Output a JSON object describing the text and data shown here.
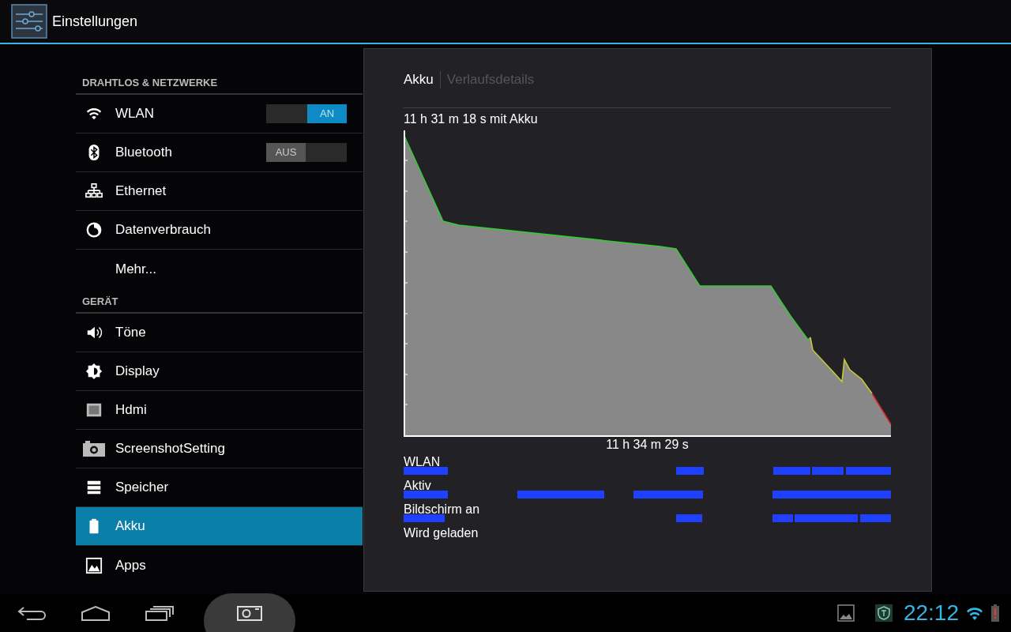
{
  "action_bar": {
    "title": "Einstellungen"
  },
  "sections": [
    {
      "header": "DRAHTLOS & NETZWERKE",
      "items": [
        {
          "label": "WLAN",
          "kind": "toggle",
          "selected": false,
          "toggle": {
            "on": true,
            "label": "AN"
          }
        },
        {
          "label": "Bluetooth",
          "kind": "toggle",
          "selected": false,
          "toggle": {
            "on": false,
            "label": "AUS"
          }
        },
        {
          "label": "Ethernet",
          "kind": "plain",
          "selected": false
        },
        {
          "label": "Datenverbrauch",
          "kind": "plain",
          "selected": false
        },
        {
          "label": "Mehr...",
          "kind": "plain",
          "selected": false
        }
      ]
    },
    {
      "header": "GERÄT",
      "items": [
        {
          "label": "Töne",
          "kind": "plain",
          "selected": false
        },
        {
          "label": "Display",
          "kind": "plain",
          "selected": false
        },
        {
          "label": "Hdmi",
          "kind": "plain",
          "selected": false
        },
        {
          "label": "ScreenshotSetting",
          "kind": "plain",
          "selected": false
        },
        {
          "label": "Speicher",
          "kind": "plain",
          "selected": false
        },
        {
          "label": "Akku",
          "kind": "plain",
          "selected": true
        },
        {
          "label": "Apps",
          "kind": "plain",
          "selected": false
        }
      ]
    }
  ],
  "detail": {
    "tabs": [
      {
        "label": "Akku",
        "selected": true
      },
      {
        "label": "Verlaufsdetails",
        "selected": false
      }
    ],
    "graph_title": "11 h 31 m 18 s mit Akku",
    "graph_axis_label": "11 h 34 m 29 s",
    "status_rows": [
      {
        "label": "WLAN"
      },
      {
        "label": "Aktiv"
      },
      {
        "label": "Bildschirm an"
      },
      {
        "label": "Wird geladen"
      }
    ]
  },
  "status_bar": {
    "time": "22:12"
  }
}
